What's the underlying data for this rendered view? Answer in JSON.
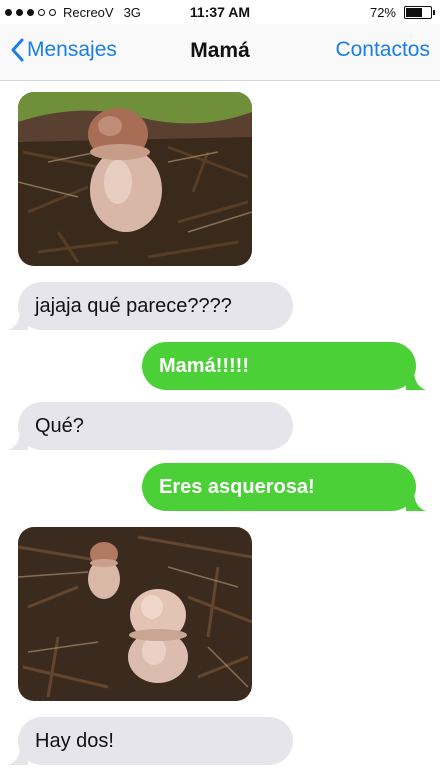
{
  "status_bar": {
    "carrier": "RecreoV",
    "network": "3G",
    "time": "11:37 AM",
    "battery": "72%",
    "battery_level": 0.72,
    "signal_bars_filled": 3,
    "signal_bars_total": 5
  },
  "nav": {
    "back_label": "Mensajes",
    "title": "Mamá",
    "contacts_label": "Contactos",
    "accent_color": "#1a7ee8"
  },
  "messages": [
    {
      "type": "image",
      "direction": "incoming",
      "icon": "mushroom-photo"
    },
    {
      "type": "text",
      "direction": "incoming",
      "text": "jajaja qué parece????"
    },
    {
      "type": "text",
      "direction": "outgoing",
      "text": "Mamá!!!!!"
    },
    {
      "type": "text",
      "direction": "incoming",
      "text": "Qué?"
    },
    {
      "type": "text",
      "direction": "outgoing",
      "text": "Eres asquerosa!"
    },
    {
      "type": "image",
      "direction": "incoming",
      "icon": "two-mushrooms-photo"
    },
    {
      "type": "text",
      "direction": "incoming",
      "text": "Hay dos!"
    }
  ],
  "colors": {
    "incoming_bubble": "#e6e5eb",
    "outgoing_bubble": "#4cd038"
  }
}
